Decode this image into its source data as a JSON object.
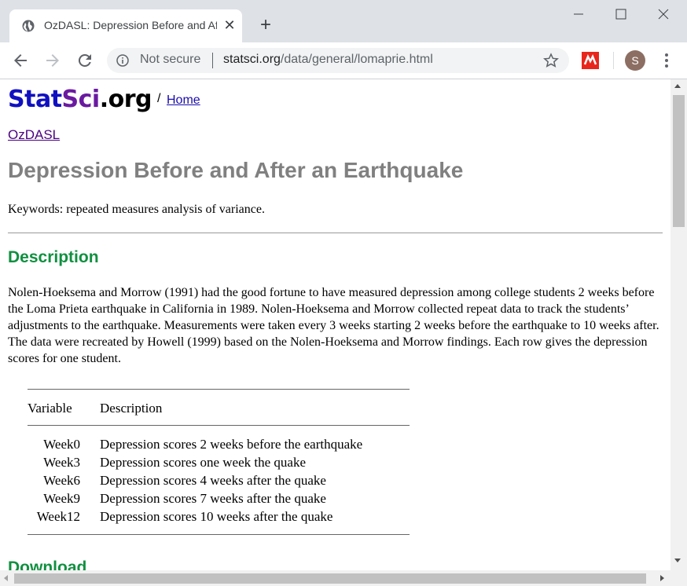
{
  "browser": {
    "tab_title": "OzDASL: Depression Before and After an Earthquake",
    "new_tab": "+",
    "close_tab": "✕",
    "security_label": "Not secure",
    "url_host": "statsci.org",
    "url_path": "/data/general/lomaprie.html",
    "avatar_initial": "S"
  },
  "page": {
    "logo_part1": "Stat",
    "logo_part2": "Sci",
    "logo_part3": ".org",
    "slash": "/",
    "home_link": "Home",
    "ozdasl_link": "OzDASL",
    "title": "Depression Before and After an Earthquake",
    "keywords": "Keywords: repeated measures analysis of variance.",
    "description_heading": "Description",
    "description_text": "Nolen-Hoeksema and Morrow (1991) had the good fortune to have measured depression among college students 2 weeks before the Loma Prieta earthquake in California in 1989. Nolen-Hoeksema and Morrow collected repeat data to track the students’ adjustments to the earthquake. Measurements were taken every 3 weeks starting 2 weeks before the earthquake to 10 weeks after. The data were recreated by Howell (1999) based on the Nolen-Hoeksema and Morrow findings. Each row gives the depression scores for one student.",
    "table": {
      "header_variable": "Variable",
      "header_description": "Description",
      "rows": [
        {
          "variable": "Week0",
          "description": "Depression scores 2 weeks before the earthquake"
        },
        {
          "variable": "Week3",
          "description": "Depression scores one week the quake"
        },
        {
          "variable": "Week6",
          "description": "Depression scores 4 weeks after the quake"
        },
        {
          "variable": "Week9",
          "description": "Depression scores 7 weeks after the quake"
        },
        {
          "variable": "Week12",
          "description": "Depression scores 10 weeks after the quake"
        }
      ]
    },
    "download_heading": "Download"
  }
}
